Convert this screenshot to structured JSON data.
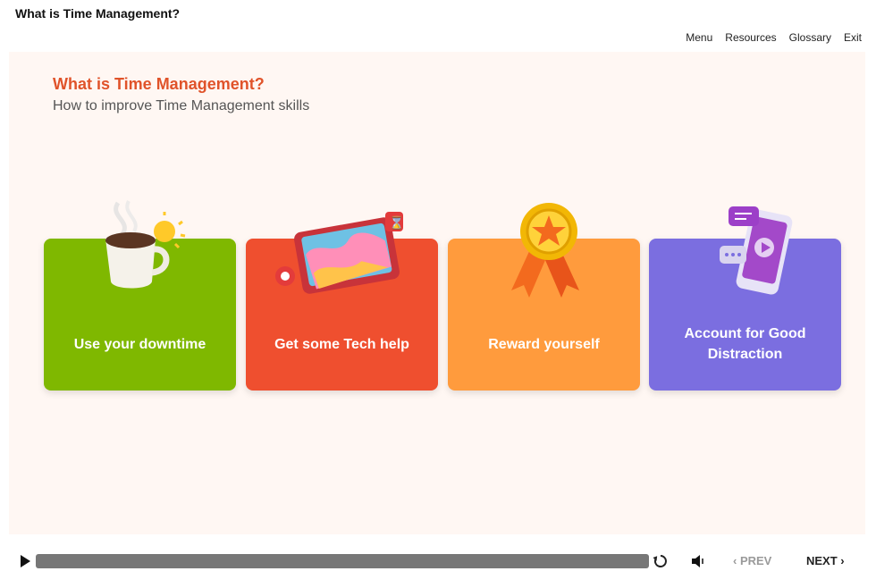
{
  "window": {
    "title": "What is Time Management?"
  },
  "topnav": {
    "menu": "Menu",
    "resources": "Resources",
    "glossary": "Glossary",
    "exit": "Exit"
  },
  "slide": {
    "title": "What is Time Management?",
    "subtitle": "How to improve Time Management skills",
    "cards": [
      {
        "label": "Use your downtime",
        "color": "#7fb800",
        "icon": "coffee-cup-icon"
      },
      {
        "label": "Get some Tech help",
        "color": "#ef4f2f",
        "icon": "tablet-puzzle-icon"
      },
      {
        "label": "Reward yourself",
        "color": "#ff9b3d",
        "icon": "medal-icon"
      },
      {
        "label": "Account for Good Distraction",
        "color": "#7b6ee0",
        "icon": "phone-chat-icon"
      }
    ]
  },
  "player": {
    "prev": "PREV",
    "next": "NEXT"
  },
  "colors": {
    "title_accent": "#e0532a",
    "slide_bg": "#fff7f3",
    "progress": "#777777"
  }
}
